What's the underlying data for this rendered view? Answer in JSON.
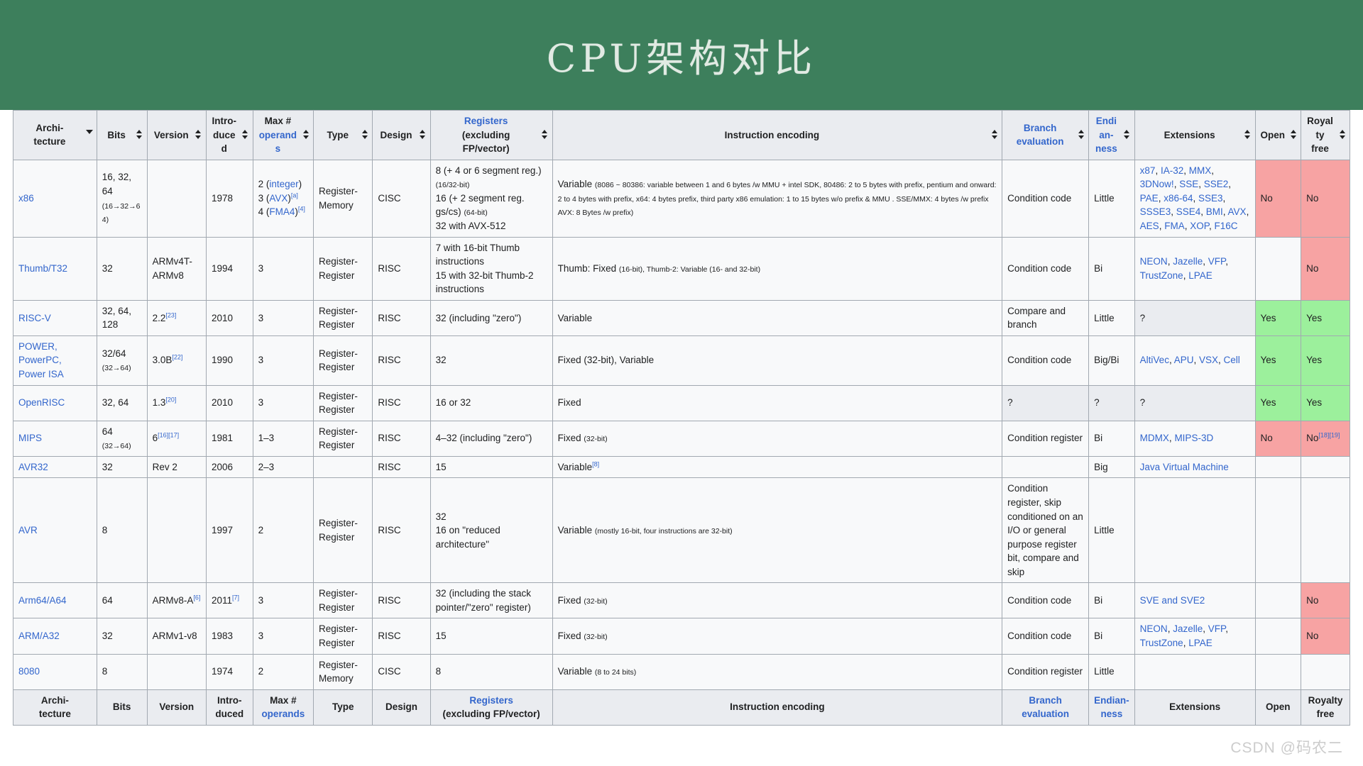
{
  "banner": {
    "title": "CPU架构对比",
    "background": "#3d7f5c",
    "text_color": "#eef3ee"
  },
  "watermark": "CSDN @码农二",
  "colors": {
    "yes": "#9cf09c",
    "no": "#f7a3a3",
    "unknown": "#eaecf0",
    "link": "#3366cc",
    "header_bg": "#eaecf0",
    "cell_bg": "#f8f9fa",
    "border": "#a2a9b1"
  },
  "table": {
    "headers": [
      {
        "line1": "Archi-",
        "line2": "tecture",
        "sort": "desc",
        "link": false
      },
      {
        "line1": "Bits",
        "line2": "",
        "sort": "both",
        "link": false
      },
      {
        "line1": "Version",
        "line2": "",
        "sort": "both",
        "link": false
      },
      {
        "line1": "Intro-",
        "line2": "duced",
        "sort": "both",
        "link": false
      },
      {
        "line1": "Max #",
        "line2": "operands",
        "sort": "both",
        "link": true,
        "link_text": "operands"
      },
      {
        "line1": "Type",
        "line2": "",
        "sort": "both",
        "link": false
      },
      {
        "line1": "Design",
        "line2": "",
        "sort": "both",
        "link": false
      },
      {
        "line1": "Registers",
        "line2": "(excluding",
        "line3": "FP/vector)",
        "sort": "both",
        "link": true,
        "link_text": "Registers"
      },
      {
        "line1": "Instruction encoding",
        "line2": "",
        "sort": "both",
        "link": false
      },
      {
        "line1": "Branch",
        "line2": "evaluation",
        "sort": "both",
        "link": true,
        "link_text": "Branch evaluation"
      },
      {
        "line1": "Endian-",
        "line2": "ness",
        "sort": "both",
        "link": true,
        "link_text": "Endianness"
      },
      {
        "line1": "Extensions",
        "line2": "",
        "sort": "both",
        "link": false
      },
      {
        "line1": "Open",
        "line2": "",
        "sort": "both",
        "link": false
      },
      {
        "line1": "Royalty",
        "line2": "free",
        "sort": "both",
        "link": false
      }
    ],
    "footer_headers": [
      {
        "line1": "Archi-",
        "line2": "tecture"
      },
      {
        "line1": "Bits",
        "line2": ""
      },
      {
        "line1": "Version",
        "line2": ""
      },
      {
        "line1": "Intro-",
        "line2": "duced"
      },
      {
        "line1": "Max #",
        "line2": "operands",
        "link_text": "operands"
      },
      {
        "line1": "Type",
        "line2": ""
      },
      {
        "line1": "Design",
        "line2": ""
      },
      {
        "line1": "Registers",
        "line2": "(excluding FP/vector)",
        "link_text": "Registers"
      },
      {
        "line1": "Instruction encoding",
        "line2": ""
      },
      {
        "line1": "Branch",
        "line2": "evaluation",
        "link_text": "Branch evaluation"
      },
      {
        "line1": "Endian-",
        "line2": "ness",
        "link_text": "Endianness"
      },
      {
        "line1": "Extensions",
        "line2": ""
      },
      {
        "line1": "Open",
        "line2": ""
      },
      {
        "line1": "Royalty",
        "line2": "free"
      }
    ],
    "rows": [
      {
        "architecture": "x86",
        "architecture_link": true,
        "bits": "16, 32, 64",
        "bits_small": "(16→32→64)",
        "version": "",
        "introduced": "1978",
        "max_operands": "2 (integer)\n3 (AVX)[a]\n4 (FMA4)[4]",
        "type": "Register-\nMemory",
        "design": "CISC",
        "registers": "8 (+ 4 or 6 segment reg.)\n(16/32-bit)\n16 (+ 2 segment reg. gs/cs) (64-bit)\n32 with AVX-512",
        "encoding": "Variable (8086 ~ 80386: variable between 1 and 6 bytes /w MMU + intel SDK, 80486: 2 to 5 bytes with prefix, pentium and onward: 2 to 4 bytes with prefix, x64: 4 bytes prefix, third party x86 emulation: 1 to 15 bytes w/o prefix & MMU . SSE/MMX: 4 bytes /w prefix AVX: 8 Bytes /w prefix)",
        "branch": "Condition code",
        "endianness": "Little",
        "extensions": "x87, IA-32, MMX, 3DNow!, SSE, SSE2, PAE, x86-64, SSE3, SSSE3, SSE4, BMI, AVX, AES, FMA, XOP, F16C",
        "open": "No",
        "open_state": "no",
        "royalty": "No",
        "royalty_state": "no"
      },
      {
        "architecture": "Thumb/T32",
        "architecture_link": true,
        "bits": "32",
        "bits_small": "",
        "version": "ARMv4T-ARMv8",
        "introduced": "1994",
        "max_operands": "3",
        "type": "Register-\nRegister",
        "design": "RISC",
        "registers": "7 with 16-bit Thumb instructions\n15 with 32-bit Thumb-2 instructions",
        "encoding": "Thumb: Fixed (16-bit), Thumb-2: Variable (16- and 32-bit)",
        "branch": "Condition code",
        "endianness": "Bi",
        "extensions": "NEON, Jazelle, VFP, TrustZone, LPAE",
        "open": "",
        "open_state": "blank",
        "royalty": "No",
        "royalty_state": "no"
      },
      {
        "architecture": "RISC-V",
        "architecture_link": true,
        "bits": "32, 64, 128",
        "bits_small": "",
        "version": "2.2[23]",
        "introduced": "2010",
        "max_operands": "3",
        "type": "Register-\nRegister",
        "design": "RISC",
        "registers": "32 (including \"zero\")",
        "encoding": "Variable",
        "branch": "Compare and branch",
        "endianness": "Little",
        "extensions": "?",
        "extensions_state": "unk",
        "open": "Yes",
        "open_state": "yes",
        "royalty": "Yes",
        "royalty_state": "yes"
      },
      {
        "architecture": "POWER, PowerPC, Power ISA",
        "architecture_link": true,
        "bits": "32/64",
        "bits_small": "(32→64)",
        "version": "3.0B[22]",
        "introduced": "1990",
        "max_operands": "3",
        "type": "Register-\nRegister",
        "design": "RISC",
        "registers": "32",
        "encoding": "Fixed (32-bit), Variable",
        "branch": "Condition code",
        "endianness": "Big/Bi",
        "extensions": "AltiVec, APU, VSX, Cell",
        "open": "Yes",
        "open_state": "yes",
        "royalty": "Yes",
        "royalty_state": "yes"
      },
      {
        "architecture": "OpenRISC",
        "architecture_link": true,
        "bits": "32, 64",
        "bits_small": "",
        "version": "1.3[20]",
        "introduced": "2010",
        "max_operands": "3",
        "type": "Register-\nRegister",
        "design": "RISC",
        "registers": "16 or 32",
        "encoding": "Fixed",
        "branch": "?",
        "branch_state": "unk",
        "endianness": "?",
        "endianness_state": "unk",
        "extensions": "?",
        "extensions_state": "unk",
        "open": "Yes",
        "open_state": "yes",
        "royalty": "Yes",
        "royalty_state": "yes"
      },
      {
        "architecture": "MIPS",
        "architecture_link": true,
        "bits": "64",
        "bits_small": "(32→64)",
        "version": "6[16][17]",
        "introduced": "1981",
        "max_operands": "1–3",
        "type": "Register-\nRegister",
        "design": "RISC",
        "registers": "4–32 (including \"zero\")",
        "encoding": "Fixed (32-bit)",
        "branch": "Condition register",
        "endianness": "Bi",
        "extensions": "MDMX, MIPS-3D",
        "open": "No",
        "open_state": "no",
        "royalty": "No[18][19]",
        "royalty_state": "no"
      },
      {
        "architecture": "AVR32",
        "architecture_link": true,
        "bits": "32",
        "bits_small": "",
        "version": "Rev 2",
        "introduced": "2006",
        "max_operands": "2–3",
        "type": "",
        "design": "RISC",
        "registers": "15",
        "encoding": "Variable[8]",
        "branch": "",
        "endianness": "Big",
        "extensions": "Java Virtual Machine",
        "open": "",
        "open_state": "blank",
        "royalty": "",
        "royalty_state": "blank"
      },
      {
        "architecture": "AVR",
        "architecture_link": true,
        "bits": "8",
        "bits_small": "",
        "version": "",
        "introduced": "1997",
        "max_operands": "2",
        "type": "Register-\nRegister",
        "design": "RISC",
        "registers": "32\n16 on \"reduced architecture\"",
        "encoding": "Variable (mostly 16-bit, four instructions are 32-bit)",
        "branch": "Condition register, skip conditioned on an I/O or general purpose register bit, compare and skip",
        "endianness": "Little",
        "extensions": "",
        "open": "",
        "open_state": "blank",
        "royalty": "",
        "royalty_state": "blank"
      },
      {
        "architecture": "Arm64/A64",
        "architecture_link": true,
        "bits": "64",
        "bits_small": "",
        "version": "ARMv8-A[6]",
        "introduced": "2011[7]",
        "max_operands": "3",
        "type": "Register-\nRegister",
        "design": "RISC",
        "registers": "32 (including the stack pointer/\"zero\" register)",
        "encoding": "Fixed (32-bit)",
        "branch": "Condition code",
        "endianness": "Bi",
        "extensions": "SVE and SVE2",
        "open": "",
        "open_state": "blank",
        "royalty": "No",
        "royalty_state": "no"
      },
      {
        "architecture": "ARM/A32",
        "architecture_link": true,
        "bits": "32",
        "bits_small": "",
        "version": "ARMv1-v8",
        "introduced": "1983",
        "max_operands": "3",
        "type": "Register-\nRegister",
        "design": "RISC",
        "registers": "15",
        "encoding": "Fixed (32-bit)",
        "branch": "Condition code",
        "endianness": "Bi",
        "extensions": "NEON, Jazelle, VFP, TrustZone, LPAE",
        "open": "",
        "open_state": "blank",
        "royalty": "No",
        "royalty_state": "no"
      },
      {
        "architecture": "8080",
        "architecture_link": true,
        "bits": "8",
        "bits_small": "",
        "version": "",
        "introduced": "1974",
        "max_operands": "2",
        "type": "Register-\nMemory",
        "design": "CISC",
        "registers": "8",
        "encoding": "Variable (8 to 24 bits)",
        "branch": "Condition register",
        "endianness": "Little",
        "extensions": "",
        "open": "",
        "open_state": "blank",
        "royalty": "",
        "royalty_state": "blank"
      }
    ]
  }
}
